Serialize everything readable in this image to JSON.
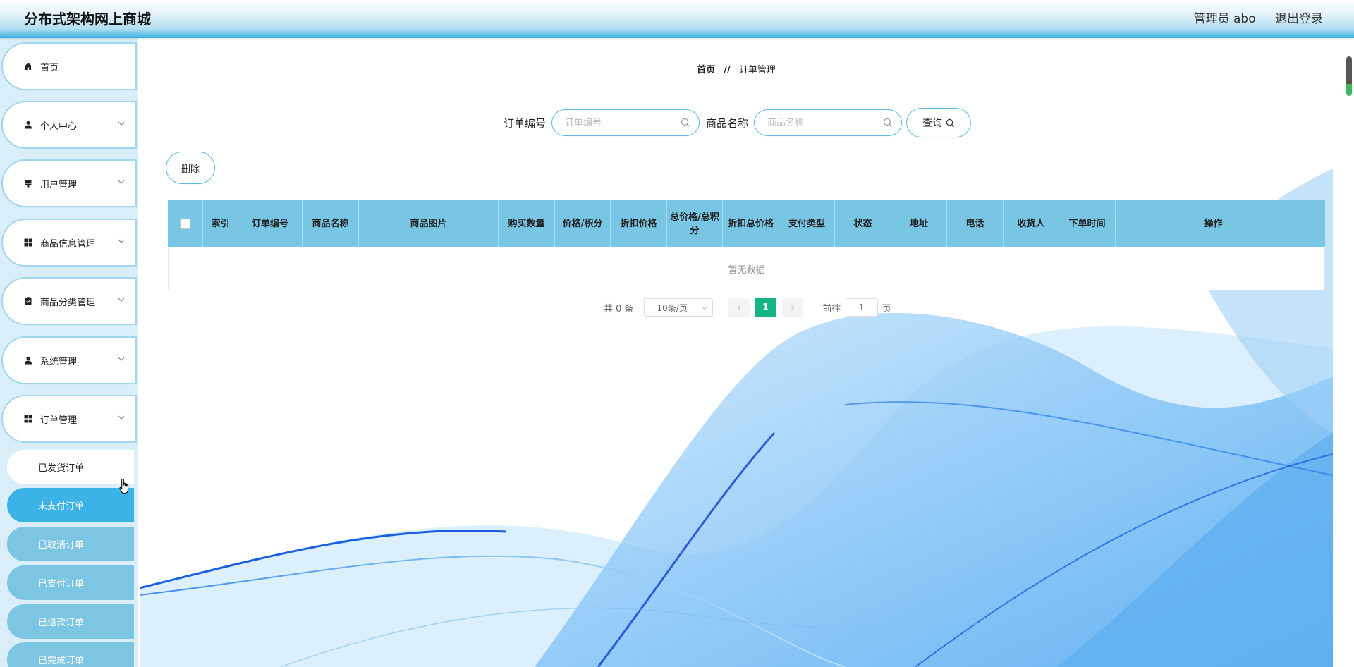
{
  "header": {
    "app_title": "分布式架构网上商城",
    "user_label": "管理员 abo",
    "logout_label": "退出登录"
  },
  "sidebar": {
    "items": [
      {
        "label": "首页",
        "icon": "home-icon",
        "expandable": false
      },
      {
        "label": "个人中心",
        "icon": "person-icon",
        "expandable": true
      },
      {
        "label": "用户管理",
        "icon": "user-manage-icon",
        "expandable": true
      },
      {
        "label": "商品信息管理",
        "icon": "grid-icon",
        "expandable": true
      },
      {
        "label": "商品分类管理",
        "icon": "clipboard-check-icon",
        "expandable": true
      },
      {
        "label": "系统管理",
        "icon": "person-icon",
        "expandable": true
      },
      {
        "label": "订单管理",
        "icon": "grid-icon",
        "expandable": true
      }
    ],
    "order_submenu": [
      {
        "label": "已发货订单",
        "state": "hover"
      },
      {
        "label": "未支付订单",
        "state": "active"
      },
      {
        "label": "已取消订单",
        "state": "normal"
      },
      {
        "label": "已支付订单",
        "state": "normal"
      },
      {
        "label": "已退款订单",
        "state": "normal"
      },
      {
        "label": "已完成订单",
        "state": "normal"
      }
    ]
  },
  "breadcrumb": {
    "home": "首页",
    "separator": "//",
    "current": "订单管理"
  },
  "search": {
    "order_no_label": "订单编号",
    "order_no_placeholder": "订单编号",
    "order_no_value": "",
    "product_name_label": "商品名称",
    "product_name_placeholder": "商品名称",
    "product_name_value": "",
    "query_label": "查询"
  },
  "actions": {
    "delete_label": "删除"
  },
  "table": {
    "columns": [
      "索引",
      "订单编号",
      "商品名称",
      "商品图片",
      "购买数量",
      "价格/积分",
      "折扣价格",
      "总价格/总积分",
      "折扣总价格",
      "支付类型",
      "状态",
      "地址",
      "电话",
      "收货人",
      "下单时间",
      "操作"
    ],
    "rows": [],
    "empty_text": "暂无数据"
  },
  "pagination": {
    "total_text": "共 0 条",
    "page_size": "10条/页",
    "current_page": "1",
    "goto_label": "前往",
    "goto_value": "1",
    "page_suffix": "页"
  },
  "colors": {
    "accent": "#3bb3e6",
    "table_header": "#79c5e4",
    "sidebar_bg": "#d9eef8",
    "pager_active": "#16b384"
  }
}
